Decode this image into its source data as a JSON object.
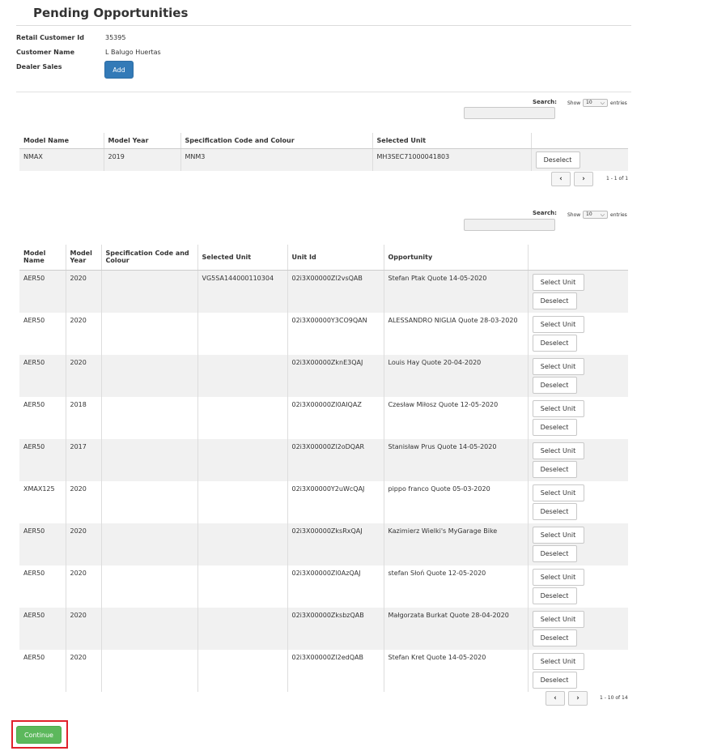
{
  "page": {
    "title": "Pending Opportunities"
  },
  "customer": {
    "retail_id_label": "Retail Customer Id",
    "retail_id_value": "35395",
    "name_label": "Customer Name",
    "name_value": "L Balugo Huertas",
    "dealer_sales_label": "Dealer Sales",
    "add_label": "Add"
  },
  "table1": {
    "search_label": "Search:",
    "show_label": "Show",
    "show_value": "10",
    "entries_label": "entries",
    "columns": [
      "Model Name",
      "Model Year",
      "Specification Code and Colour",
      "Selected Unit",
      ""
    ],
    "rows": [
      {
        "model": "NMAX",
        "year": "2019",
        "spec": "MNM3",
        "unit": "MH3SEC71000041803",
        "deselect": "Deselect"
      }
    ],
    "pager_info": "1 - 1 of 1"
  },
  "table2": {
    "search_label": "Search:",
    "show_label": "Show",
    "show_value": "10",
    "entries_label": "entries",
    "columns": [
      "Model Name",
      "Model Year",
      "Specification Code and Colour",
      "Selected Unit",
      "Unit Id",
      "Opportunity",
      ""
    ],
    "rows": [
      {
        "model": "AER50",
        "year": "2020",
        "spec": "",
        "selected": "VG5SA144000110304",
        "unit_id": "02i3X00000Zl2vsQAB",
        "opportunity": "Stefan Ptak Quote 14-05-2020",
        "select": "Select Unit",
        "deselect": "Deselect"
      },
      {
        "model": "AER50",
        "year": "2020",
        "spec": "",
        "selected": "",
        "unit_id": "02i3X00000Y3CO9QAN",
        "opportunity": "ALESSANDRO NIGLIA Quote 28-03-2020",
        "select": "Select Unit",
        "deselect": "Deselect"
      },
      {
        "model": "AER50",
        "year": "2020",
        "spec": "",
        "selected": "",
        "unit_id": "02i3X00000ZknE3QAJ",
        "opportunity": "Louis Hay Quote 20-04-2020",
        "select": "Select Unit",
        "deselect": "Deselect"
      },
      {
        "model": "AER50",
        "year": "2018",
        "spec": "",
        "selected": "",
        "unit_id": "02i3X00000Zl0AIQAZ",
        "opportunity": "Czesław Miłosz Quote 12-05-2020",
        "select": "Select Unit",
        "deselect": "Deselect"
      },
      {
        "model": "AER50",
        "year": "2017",
        "spec": "",
        "selected": "",
        "unit_id": "02i3X00000Zl2oDQAR",
        "opportunity": "Stanisław Prus Quote 14-05-2020",
        "select": "Select Unit",
        "deselect": "Deselect"
      },
      {
        "model": "XMAX125",
        "year": "2020",
        "spec": "",
        "selected": "",
        "unit_id": "02i3X00000Y2uWcQAJ",
        "opportunity": "pippo franco Quote 05-03-2020",
        "select": "Select Unit",
        "deselect": "Deselect"
      },
      {
        "model": "AER50",
        "year": "2020",
        "spec": "",
        "selected": "",
        "unit_id": "02i3X00000ZksRxQAJ",
        "opportunity": "Kazimierz Wielki's MyGarage Bike",
        "select": "Select Unit",
        "deselect": "Deselect"
      },
      {
        "model": "AER50",
        "year": "2020",
        "spec": "",
        "selected": "",
        "unit_id": "02i3X00000Zl0AzQAJ",
        "opportunity": "stefan Słoń Quote 12-05-2020",
        "select": "Select Unit",
        "deselect": "Deselect"
      },
      {
        "model": "AER50",
        "year": "2020",
        "spec": "",
        "selected": "",
        "unit_id": "02i3X00000ZksbzQAB",
        "opportunity": "Małgorzata Burkat Quote 28-04-2020",
        "select": "Select Unit",
        "deselect": "Deselect"
      },
      {
        "model": "AER50",
        "year": "2020",
        "spec": "",
        "selected": "",
        "unit_id": "02i3X00000Zl2edQAB",
        "opportunity": "Stefan Kret Quote 14-05-2020",
        "select": "Select Unit",
        "deselect": "Deselect"
      }
    ],
    "pager_info": "1 - 10 of 14"
  },
  "footer": {
    "continue_label": "Continue"
  },
  "icons": {
    "prev": "chevron-left-icon",
    "next": "chevron-right-icon",
    "dropdown": "chevron-down-icon"
  },
  "colors": {
    "primary": "#337ab7",
    "success": "#5cb85c",
    "highlight": "#e0212b"
  }
}
